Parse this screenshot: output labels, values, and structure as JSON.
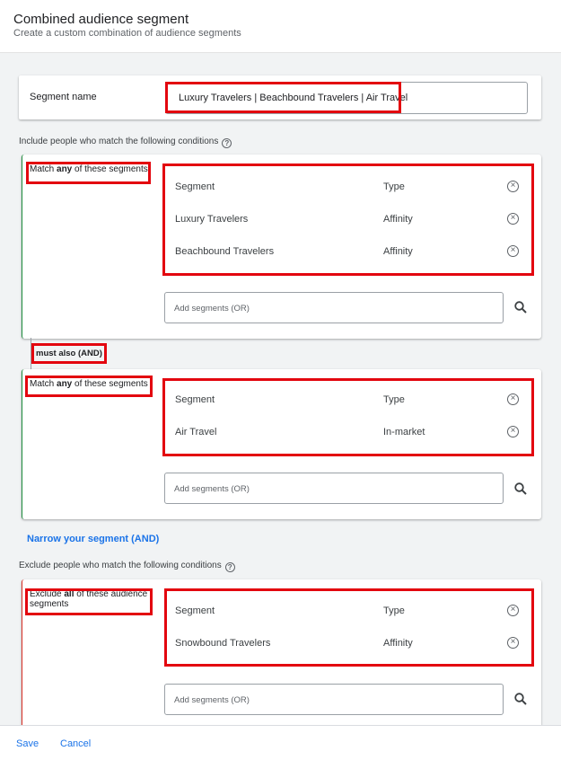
{
  "header": {
    "title": "Combined audience segment",
    "subtitle": "Create a custom combination of audience segments"
  },
  "segment_name": {
    "label": "Segment name",
    "value": "Luxury Travelers | Beachbound Travelers | Air Travel"
  },
  "include": {
    "label": "Include people who match the following conditions",
    "help_icon": "help-circle-icon",
    "groups": [
      {
        "match_prefix": "Match ",
        "match_keyword": "any",
        "match_suffix": " of these segments",
        "header": {
          "segment": "Segment",
          "type": "Type"
        },
        "rows": [
          {
            "segment": "Luxury Travelers",
            "type": "Affinity"
          },
          {
            "segment": "Beachbound Travelers",
            "type": "Affinity"
          }
        ],
        "add_placeholder": "Add segments (OR)"
      },
      {
        "match_prefix": "Match ",
        "match_keyword": "any",
        "match_suffix": " of these segments",
        "header": {
          "segment": "Segment",
          "type": "Type"
        },
        "rows": [
          {
            "segment": "Air Travel",
            "type": "In-market"
          }
        ],
        "add_placeholder": "Add segments (OR)"
      }
    ],
    "connector_label": "must also (AND)",
    "narrow_link": "Narrow your segment (AND)"
  },
  "exclude": {
    "label": "Exclude people who match the following conditions",
    "help_icon": "help-circle-icon",
    "group": {
      "match_prefix": "Exclude ",
      "match_keyword": "all",
      "match_suffix": " of these audience segments",
      "header": {
        "segment": "Segment",
        "type": "Type"
      },
      "rows": [
        {
          "segment": "Snowbound Travelers",
          "type": "Affinity"
        }
      ],
      "add_placeholder": "Add segments (OR)"
    }
  },
  "footer": {
    "save": "Save",
    "cancel": "Cancel"
  },
  "colors": {
    "accent": "#1a73e8",
    "highlight": "#e3060f",
    "include_border": "#1e8e3e",
    "exclude_border": "#d93025"
  }
}
